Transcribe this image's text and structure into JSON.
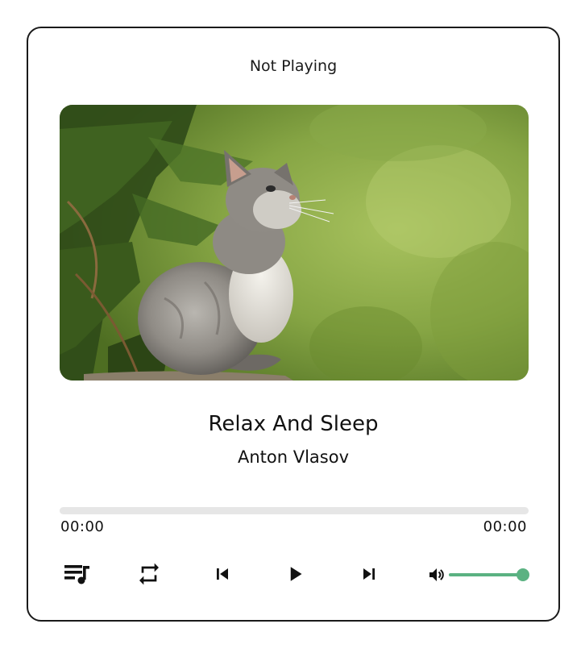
{
  "player": {
    "status": "Not Playing",
    "track": {
      "title": "Relax And Sleep",
      "artist": "Anton Vlasov"
    },
    "progress": {
      "current_time": "00:00",
      "total_time": "00:00",
      "fraction": 0
    },
    "controls": {
      "playlist_icon": "playlist-music-icon",
      "repeat_icon": "repeat-icon",
      "previous_icon": "skip-previous-icon",
      "play_icon": "play-icon",
      "next_icon": "skip-next-icon",
      "volume_icon": "volume-icon"
    },
    "volume": {
      "level": 1.0
    },
    "colors": {
      "accent": "#5bb282",
      "track": "#e6e6e6",
      "border": "#1a1a1a"
    },
    "cover_art": {
      "subject": "kitten-photo"
    }
  }
}
